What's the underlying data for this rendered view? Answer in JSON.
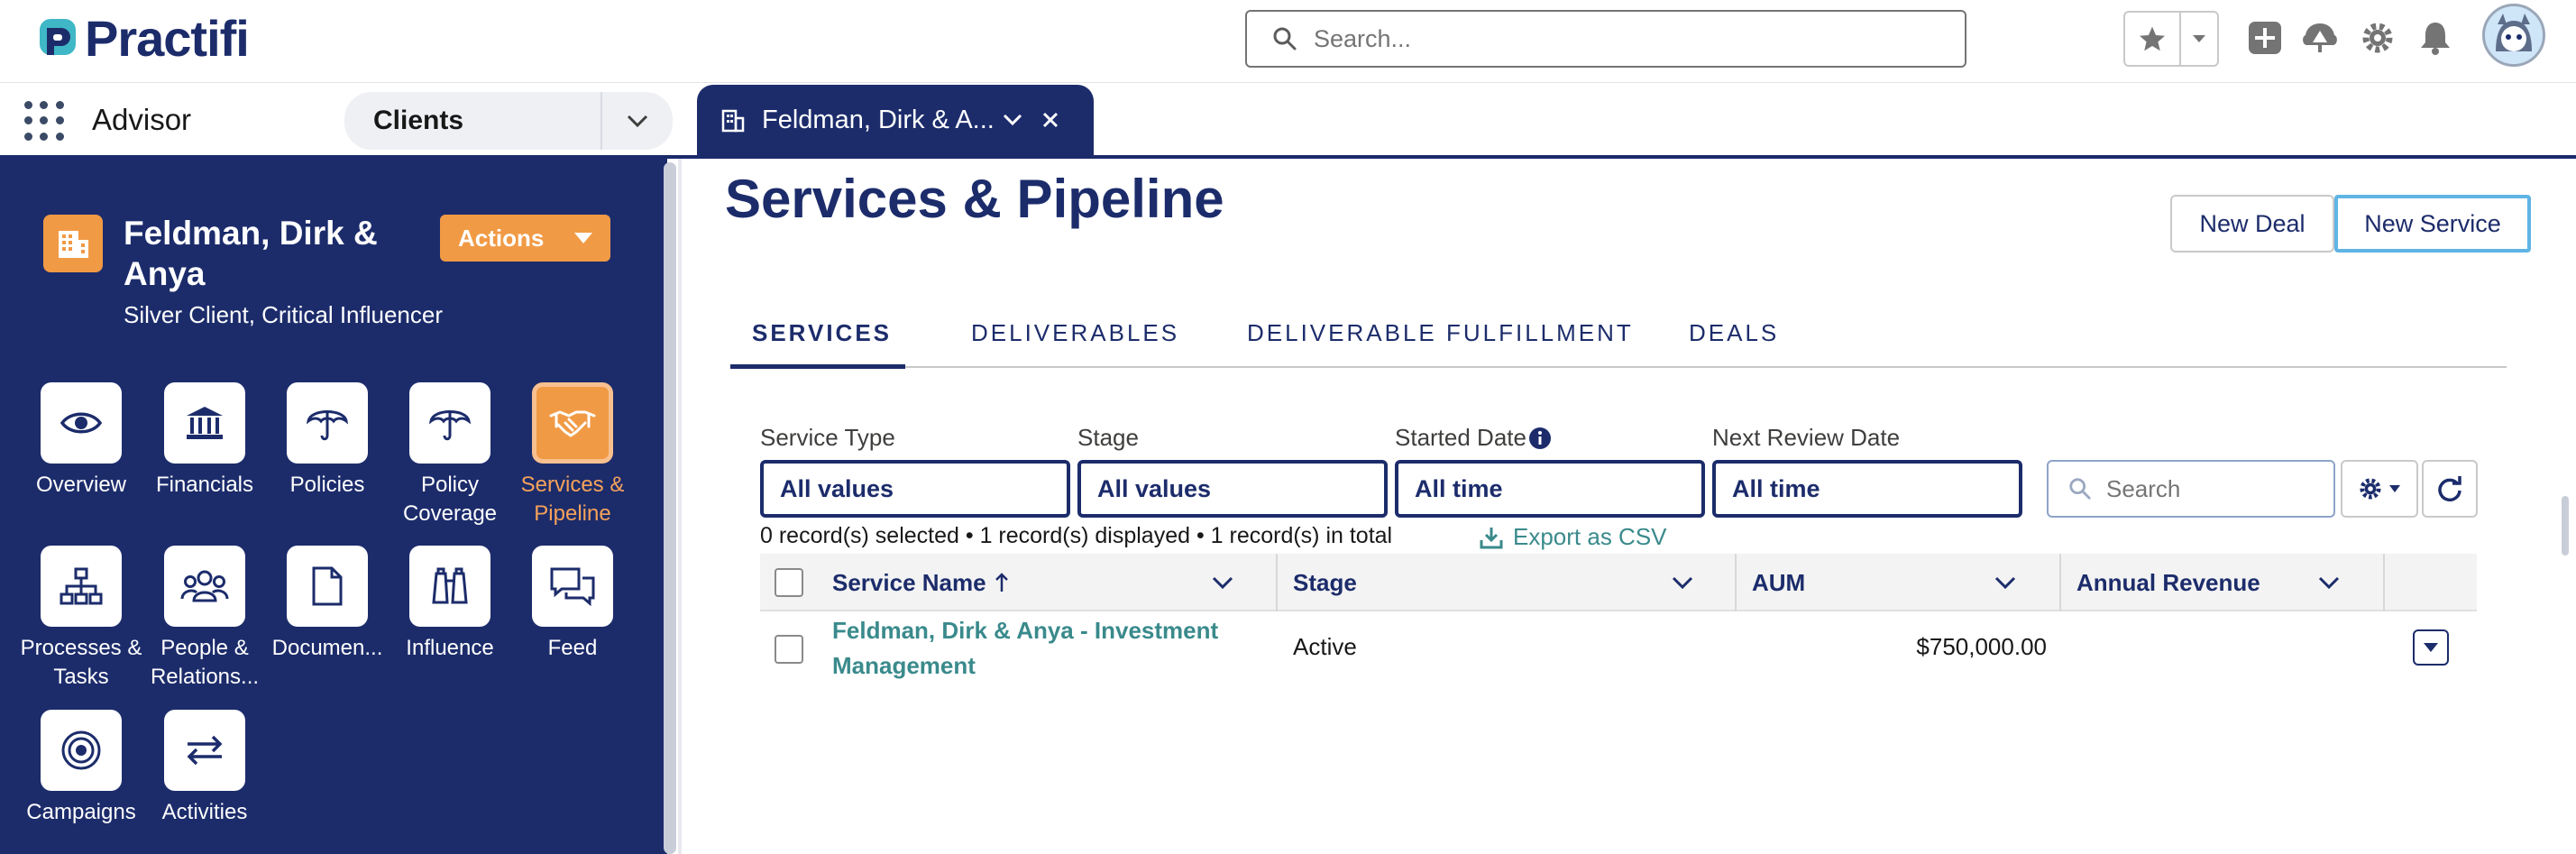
{
  "header": {
    "logo_text": "Practifi",
    "search_placeholder": "Search...",
    "brand_color": "#1c2c6b",
    "accent_color": "#f19a45",
    "icons": [
      "star-icon",
      "chevron-down-icon",
      "plus-icon",
      "trailhead-icon",
      "gear-icon",
      "bell-icon",
      "avatar"
    ]
  },
  "nav": {
    "app_name": "Advisor",
    "object_tab": "Clients",
    "record_tab": "Feldman, Dirk & A..."
  },
  "sidebar": {
    "account_name": "Feldman, Dirk & Anya",
    "account_subtitle": "Silver Client, Critical Influencer",
    "actions_label": "Actions",
    "tiles": [
      {
        "label": "Overview",
        "icon": "eye-icon"
      },
      {
        "label": "Financials",
        "icon": "bank-icon"
      },
      {
        "label": "Policies",
        "icon": "umbrella-icon"
      },
      {
        "label": "Policy Coverage",
        "icon": "umbrella-icon"
      },
      {
        "label": "Services & Pipeline",
        "icon": "handshake-icon",
        "active": true
      },
      {
        "label": "Processes & Tasks",
        "icon": "hierarchy-icon"
      },
      {
        "label": "People & Relations...",
        "icon": "people-icon"
      },
      {
        "label": "Documen...",
        "icon": "document-icon"
      },
      {
        "label": "Influence",
        "icon": "binoculars-icon"
      },
      {
        "label": "Feed",
        "icon": "chat-icon"
      },
      {
        "label": "Campaigns",
        "icon": "target-icon"
      },
      {
        "label": "Activities",
        "icon": "arrows-icon"
      }
    ]
  },
  "main": {
    "title": "Services & Pipeline",
    "new_deal": "New Deal",
    "new_service": "New Service",
    "tabs": [
      "SERVICES",
      "DELIVERABLES",
      "DELIVERABLE FULFILLMENT",
      "DEALS"
    ],
    "filters": [
      {
        "label": "Service Type",
        "value": "All values"
      },
      {
        "label": "Stage",
        "value": "All values"
      },
      {
        "label": "Started Date",
        "value": "All time"
      },
      {
        "label": "Next Review Date",
        "value": "All time"
      }
    ],
    "table_search_placeholder": "Search",
    "summary": "0 record(s) selected • 1 record(s) displayed • 1 record(s) in total",
    "export_label": "Export as CSV",
    "columns": [
      "Service Name",
      "Stage",
      "AUM",
      "Annual Revenue"
    ],
    "rows": [
      {
        "service_name": "Feldman, Dirk & Anya - Investment Management",
        "stage": "Active",
        "aum": "$750,000.00",
        "annual_revenue": ""
      }
    ]
  }
}
